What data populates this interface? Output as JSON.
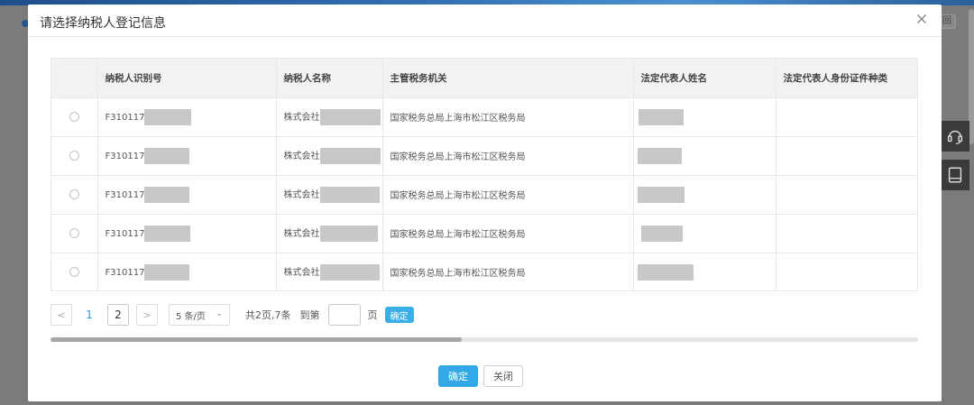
{
  "background": {
    "corner_button": "回"
  },
  "modal": {
    "title": "请选择纳税人登记信息",
    "columns": [
      "",
      "纳税人识别号",
      "纳税人名称",
      "主管税务机关",
      "法定代表人姓名",
      "法定代表人身份证件种类"
    ],
    "rows": [
      {
        "tax_id_prefix": "F310117",
        "name_prefix": "株式会社",
        "authority": "国家税务总局上海市松江区税务局"
      },
      {
        "tax_id_prefix": "F310117",
        "name_prefix": "株式会社",
        "authority": "国家税务总局上海市松江区税务局"
      },
      {
        "tax_id_prefix": "F310117",
        "name_prefix": "株式会社",
        "authority": "国家税务总局上海市松江区税务局"
      },
      {
        "tax_id_prefix": "F310117",
        "name_prefix": "株式会社",
        "authority": "国家税务总局上海市松江区税务局"
      },
      {
        "tax_id_prefix": "F310117",
        "name_prefix": "株式会社",
        "authority": "国家税务总局上海市松江区税务局"
      }
    ],
    "pagination": {
      "prev": "<",
      "pages": [
        "1",
        "2"
      ],
      "next": ">",
      "page_size": "5 条/页",
      "summary": "共2页,7条",
      "goto_label": "到第",
      "page_label": "页",
      "confirm": "确定"
    },
    "footer": {
      "ok": "确定",
      "close": "关闭"
    }
  }
}
